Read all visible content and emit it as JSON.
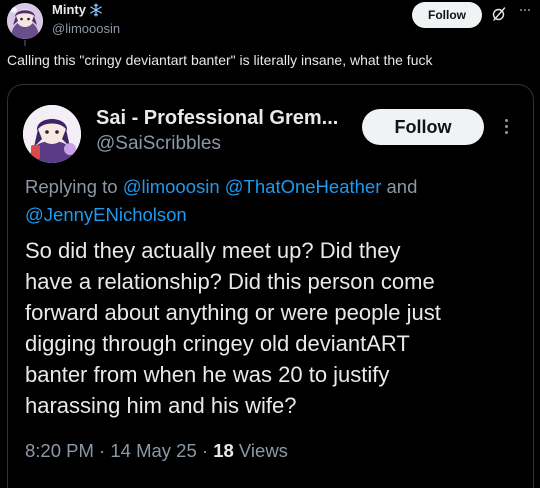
{
  "outer_post": {
    "display_name": "Minty",
    "handle": "@limooosin",
    "follow_label": "Follow",
    "text": "Calling this \"cringy deviantart banter\" is literally insane, what the fuck",
    "icons": {
      "name_badge": "snowflake-icon",
      "grok": "grok-icon",
      "more": "more-horizontal-icon"
    }
  },
  "quoted_post": {
    "display_name": "Sai - Professional Grem...",
    "handle": "@SaiScribbles",
    "follow_label": "Follow",
    "replying_prefix": "Replying to",
    "mentions": [
      "@limooosin",
      "@ThatOneHeather",
      "@JennyENicholson"
    ],
    "replying_and": "and",
    "body": "So did they actually meet up? Did they\nhave a relationship? Did this person come\nforward about anything or were people just\ndigging through cringey old deviantART\nbanter from when he was 20 to justify\nharassing him and his wife?",
    "time": "8:20 PM",
    "sep1": "·",
    "date": "14 May 25",
    "sep2": "·",
    "views_count": "18",
    "views_label": "Views",
    "icons": {
      "more": "more-vertical-icon"
    }
  },
  "colors": {
    "background": "#000000",
    "text_primary": "#e7e9ea",
    "text_secondary": "#8b98a5",
    "link": "#1d9bf0",
    "border": "#2f3336",
    "button_bg": "#eff3f4",
    "button_text": "#0f1419"
  }
}
